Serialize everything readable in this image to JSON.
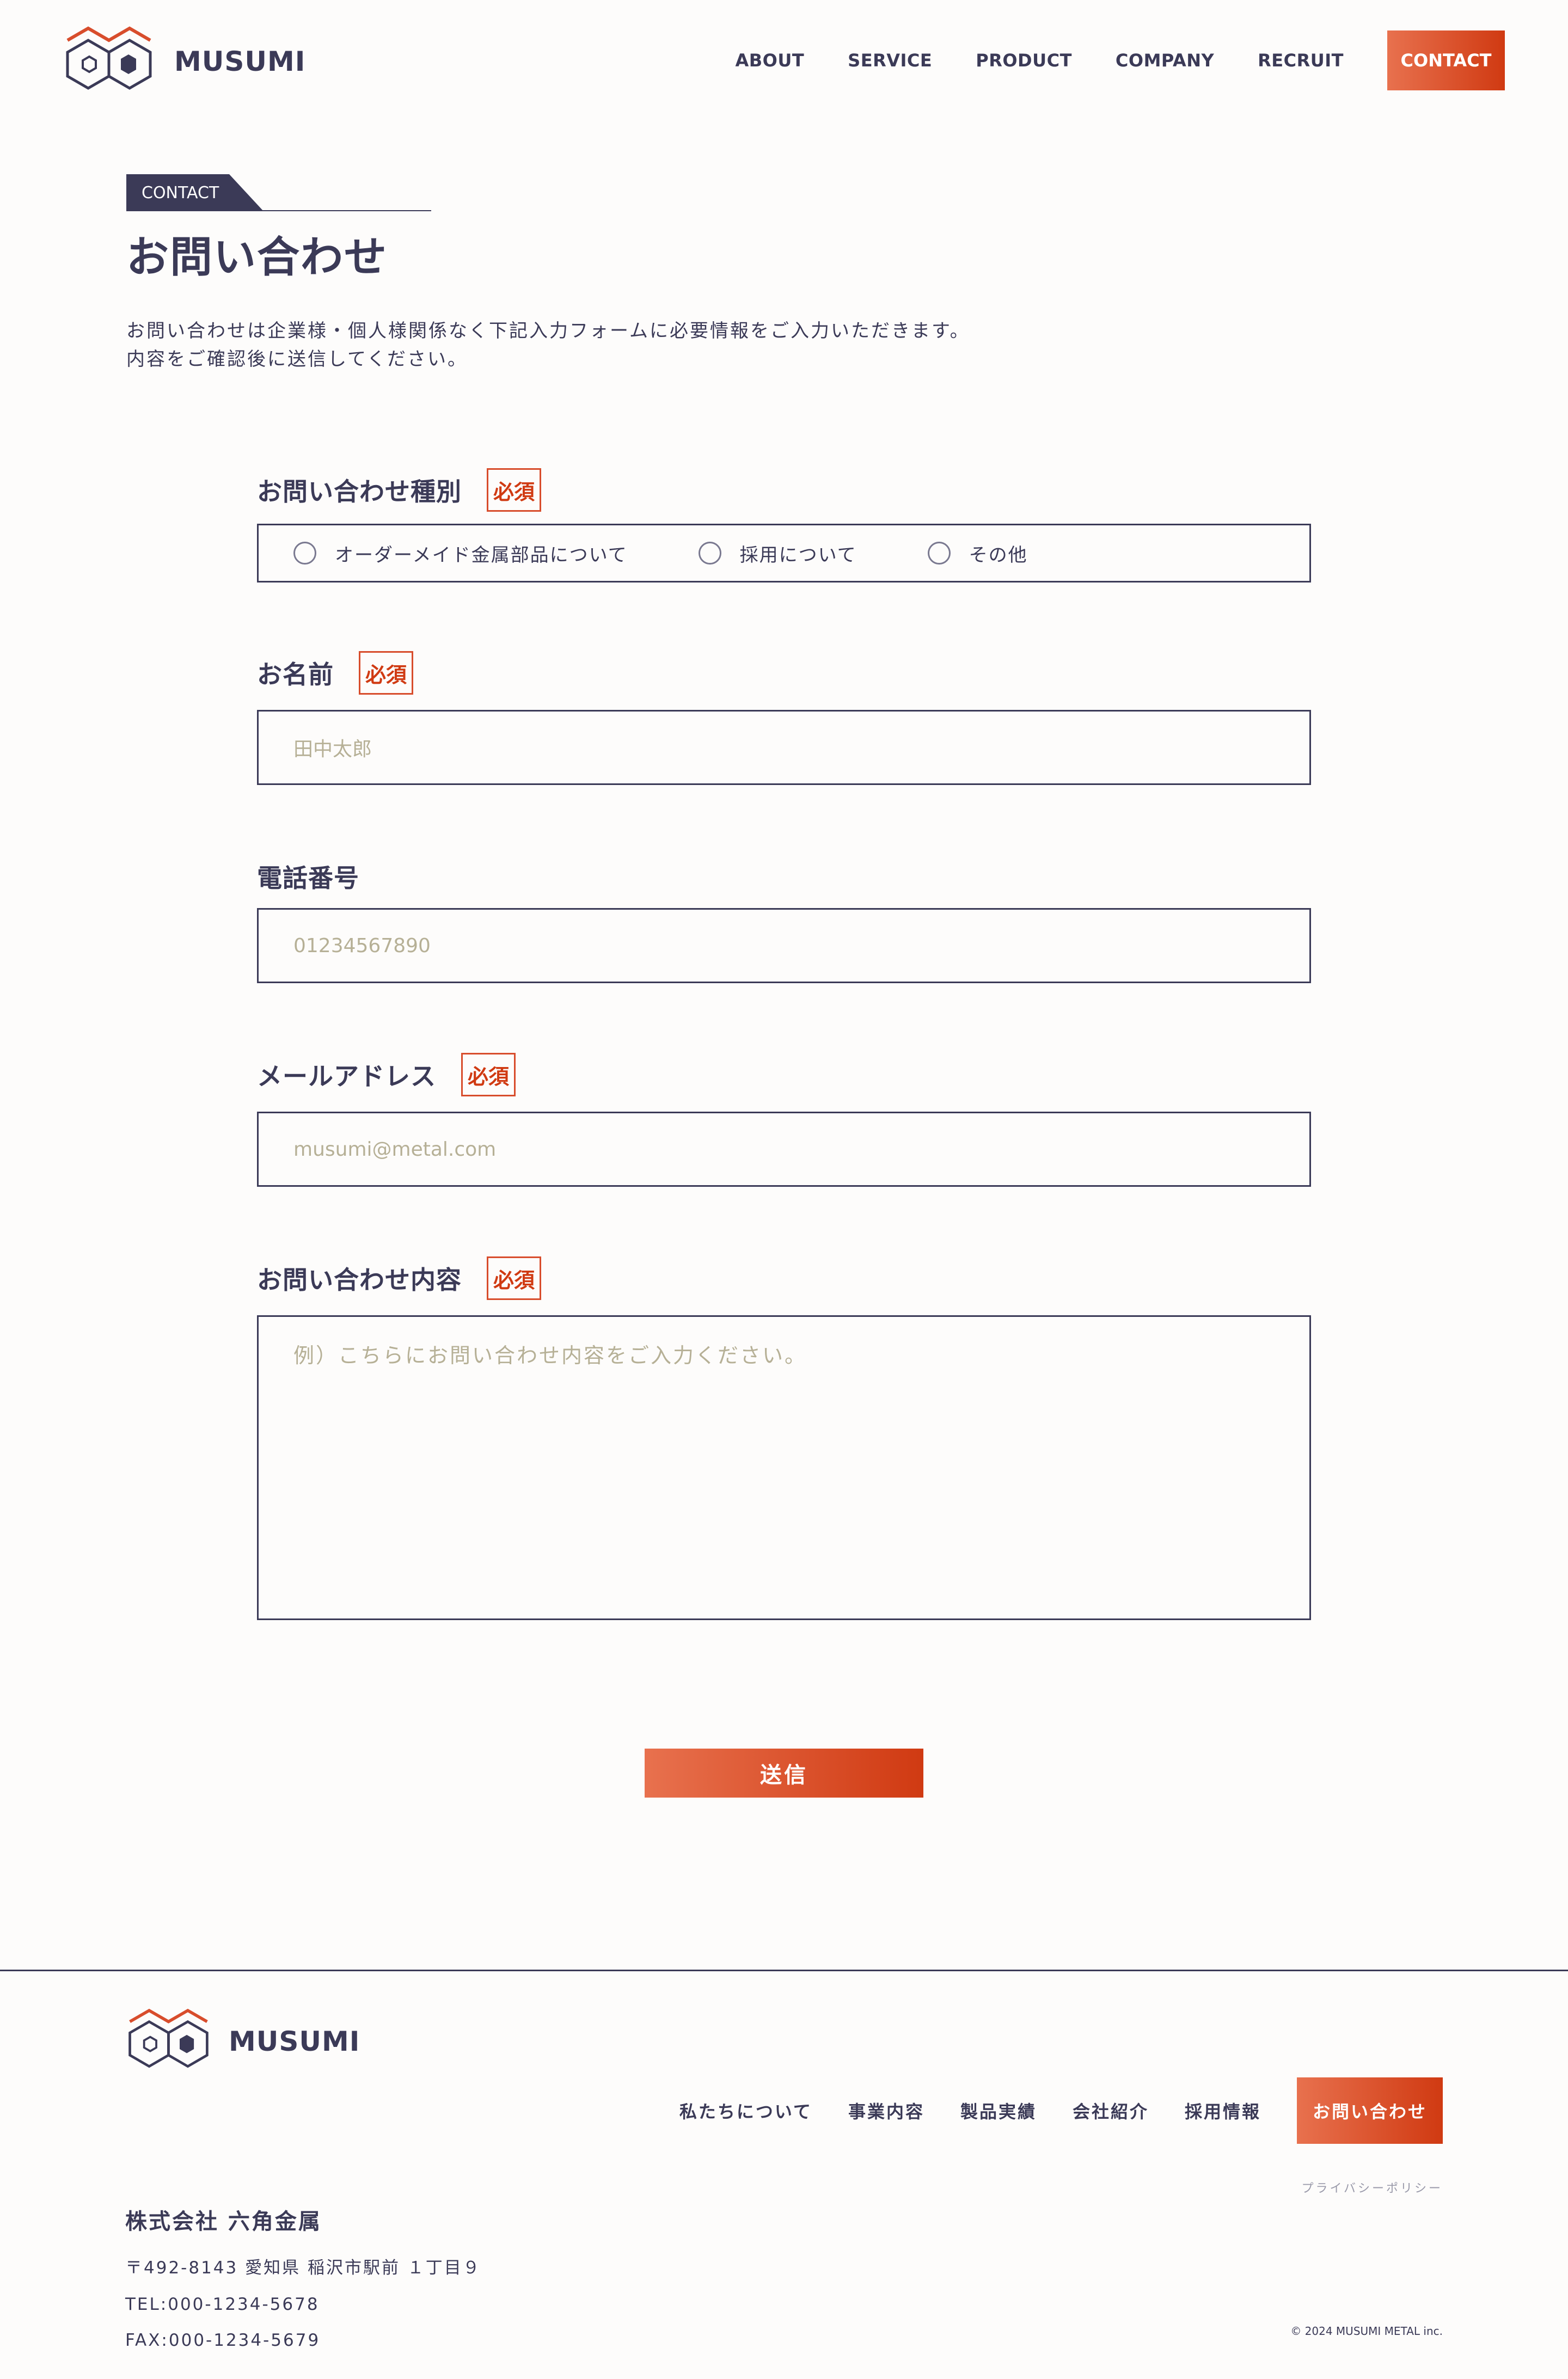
{
  "header": {
    "logo_text": "MUSUMI",
    "nav": [
      "ABOUT",
      "SERVICE",
      "PRODUCT",
      "COMPANY",
      "RECRUIT"
    ],
    "contact_label": "CONTACT"
  },
  "pagehead": {
    "tag": "CONTACT",
    "title": "お問い合わせ",
    "lead_1": "お問い合わせは企業様・個人様関係なく下記入力フォームに必要情報をご入力いただきます。",
    "lead_2": "内容をご確認後に送信してください。"
  },
  "form": {
    "required_label": "必須",
    "type": {
      "label": "お問い合わせ種別",
      "options": [
        "オーダーメイド金属部品について",
        "採用について",
        "その他"
      ]
    },
    "name": {
      "label": "お名前",
      "placeholder": "田中太郎"
    },
    "phone": {
      "label": "電話番号",
      "placeholder": "01234567890"
    },
    "email": {
      "label": "メールアドレス",
      "placeholder": "musumi@metal.com"
    },
    "message": {
      "label": "お問い合わせ内容",
      "placeholder": "例）こちらにお問い合わせ内容をご入力ください。"
    },
    "submit_label": "送信"
  },
  "footer": {
    "logo_text": "MUSUMI",
    "nav": [
      "私たちについて",
      "事業内容",
      "製品実績",
      "会社紹介",
      "採用情報"
    ],
    "contact_label": "お問い合わせ",
    "privacy": "プライバシーポリシー",
    "company_name": "株式会社 六角金属",
    "address": "〒492-8143 愛知県 稲沢市駅前 １丁目９",
    "tel": "TEL:000-1234-5678",
    "fax": "FAX:000-1234-5679",
    "copyright": "© 2024 MUSUMI METAL inc."
  },
  "colors": {
    "navy": "#3b3a57",
    "accent_start": "#e8714e",
    "accent_end": "#d03a12",
    "placeholder": "#b6b096"
  }
}
